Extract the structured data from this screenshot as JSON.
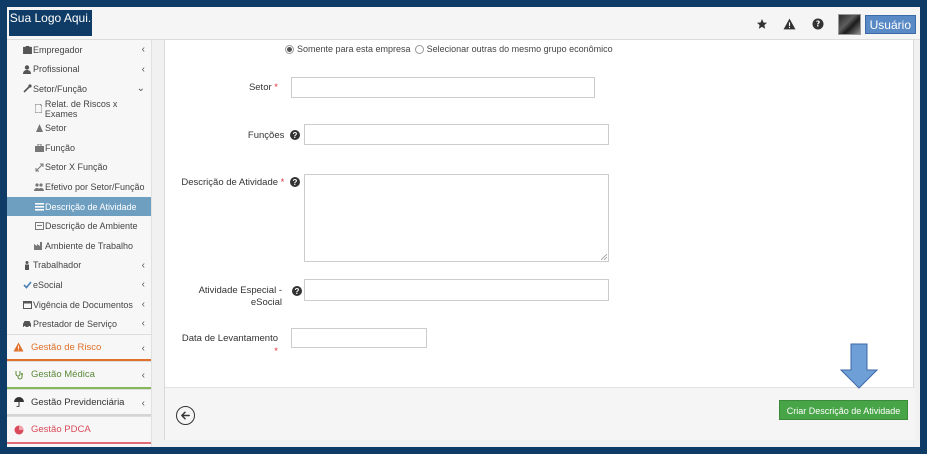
{
  "header": {
    "logo_text": "Sua Logo Aqui.",
    "icons": [
      "star-icon",
      "warning-icon",
      "help-icon"
    ],
    "user_label": "Usuário"
  },
  "sidebar": {
    "items": [
      {
        "label": "Empregador",
        "icon": "building-icon",
        "level": 1,
        "chevron": "‹"
      },
      {
        "label": "Profissional",
        "icon": "user-icon",
        "level": 1,
        "chevron": "‹"
      },
      {
        "label": "Setor/Função",
        "icon": "tools-icon",
        "level": 1,
        "chevron": "⌄"
      },
      {
        "label": "Relat. de Riscos x Exames",
        "icon": "file-icon",
        "level": 2
      },
      {
        "label": "Setor",
        "icon": "sitemap-icon",
        "level": 2
      },
      {
        "label": "Função",
        "icon": "briefcase-icon",
        "level": 2
      },
      {
        "label": "Setor X Função",
        "icon": "link-icon",
        "level": 2
      },
      {
        "label": "Efetivo por Setor/Função",
        "icon": "users-icon",
        "level": 2
      },
      {
        "label": "Descrição de Atividade",
        "icon": "list-icon",
        "level": 2,
        "active": true
      },
      {
        "label": "Descrição de Ambiente",
        "icon": "list-alt-icon",
        "level": 2
      },
      {
        "label": "Ambiente de Trabalho",
        "icon": "factory-icon",
        "level": 2
      },
      {
        "label": "Trabalhador",
        "icon": "person-icon",
        "level": 1,
        "chevron": "‹"
      },
      {
        "label": "eSocial",
        "icon": "check-icon",
        "level": 1,
        "chevron": "‹"
      },
      {
        "label": "Vigência de Documentos",
        "icon": "calendar-icon",
        "level": 1,
        "chevron": "‹"
      },
      {
        "label": "Prestador de Serviço",
        "icon": "car-icon",
        "level": 1,
        "chevron": "‹"
      }
    ],
    "groups": [
      {
        "label": "Gestão de Risco",
        "icon": "warning-icon",
        "chevron": "‹"
      },
      {
        "label": "Gestão Médica",
        "icon": "stethoscope-icon",
        "chevron": "‹"
      },
      {
        "label": "Gestão Previdenciária",
        "icon": "umbrella-icon",
        "chevron": "‹"
      },
      {
        "label": "Gestão PDCA",
        "icon": "pie-chart-icon",
        "chevron": ""
      }
    ]
  },
  "form": {
    "radio_options": [
      {
        "label": "Somente para esta empresa",
        "selected": true
      },
      {
        "label": "Selecionar outras do mesmo grupo econômico",
        "selected": false
      }
    ],
    "setor_label": "Setor",
    "funcoes_label": "Funções",
    "descricao_label": "Descrição de Atividade",
    "especial_label_line1": "Atividade Especial -",
    "especial_label_line2": "eSocial",
    "data_label": "Data de Levantamento",
    "required_mark": "*",
    "help_mark": "?",
    "create_button": "Criar  Descrição de Atividade"
  },
  "colors": {
    "page_bg": "#0f3c66",
    "active_item": "#6e9fc0",
    "create_button": "#47a447",
    "annotation_arrow": "#6e9fd6"
  }
}
